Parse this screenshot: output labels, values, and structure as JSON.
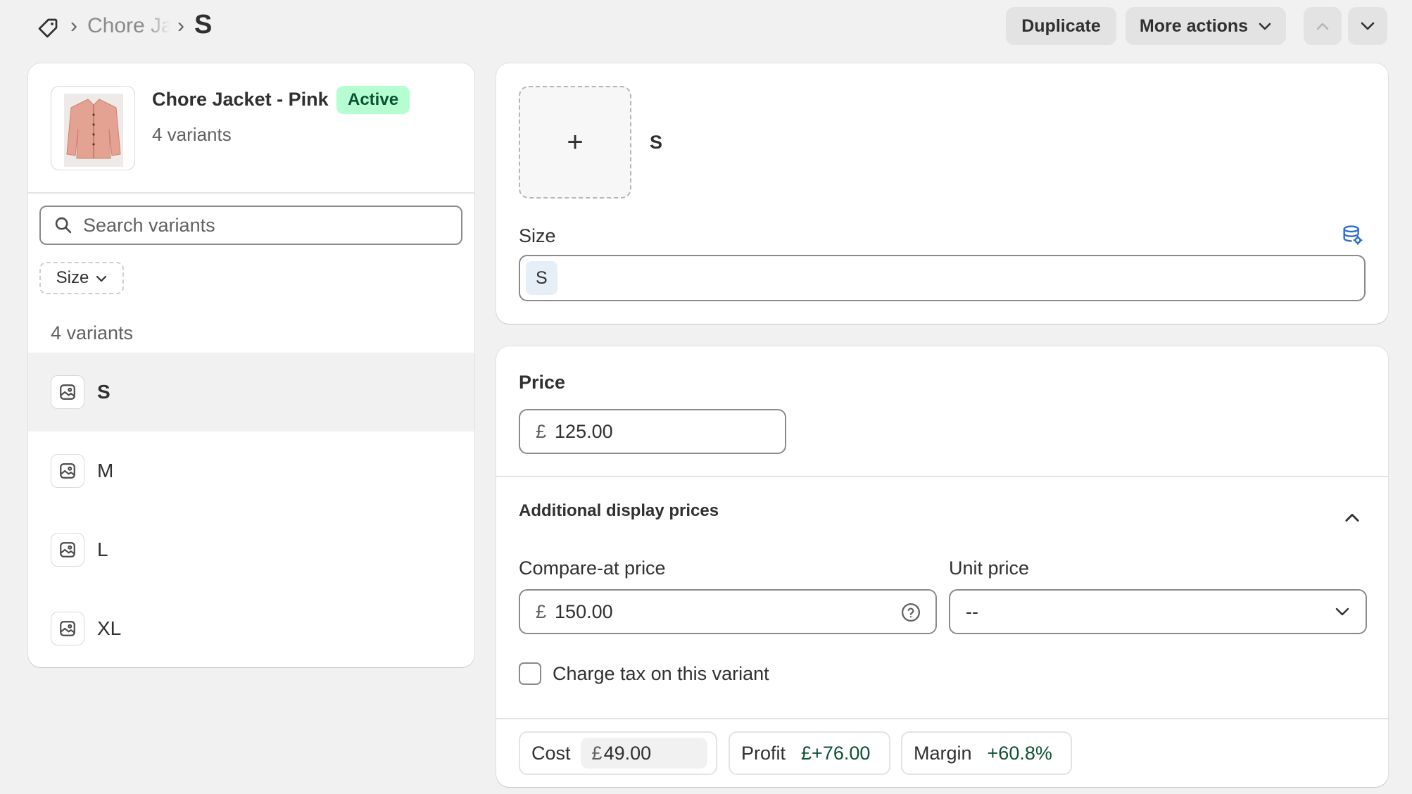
{
  "breadcrumb": {
    "parent_label": "Chore Jacket - Pink",
    "current_label": "S",
    "separator": "›"
  },
  "header_actions": {
    "duplicate_label": "Duplicate",
    "more_actions_label": "More actions"
  },
  "product": {
    "name": "Chore Jacket - Pink",
    "status": "Active",
    "variant_count_label": "4 variants"
  },
  "variant_list": {
    "search_placeholder": "Search variants",
    "filter_label": "Size",
    "count_label": "4 variants",
    "items": [
      {
        "label": "S",
        "selected": true
      },
      {
        "label": "M",
        "selected": false
      },
      {
        "label": "L",
        "selected": false
      },
      {
        "label": "XL",
        "selected": false
      }
    ]
  },
  "variant": {
    "title": "S",
    "add_media_glyph": "+",
    "size_label": "Size",
    "size_value": "S"
  },
  "pricing": {
    "price_label": "Price",
    "currency_symbol": "£",
    "price_value": "125.00",
    "additional_title": "Additional display prices",
    "compare_label": "Compare-at price",
    "compare_value": "150.00",
    "unit_label": "Unit price",
    "unit_value": "--",
    "charge_tax_label": "Charge tax on this variant",
    "charge_tax_checked": false,
    "cost_label": "Cost",
    "cost_value": "49.00",
    "profit_label": "Profit",
    "profit_value": "£+76.00",
    "margin_label": "Margin",
    "margin_value": "+60.8%"
  },
  "colors": {
    "page_bg": "#f1f1f1",
    "card_bg": "#ffffff",
    "badge_active_bg": "#b4fed2",
    "badge_active_text": "#0c5132",
    "selected_row_bg": "#f1f1f1",
    "positive_text": "#0c5132",
    "metafield_icon": "#2c6ecb"
  }
}
